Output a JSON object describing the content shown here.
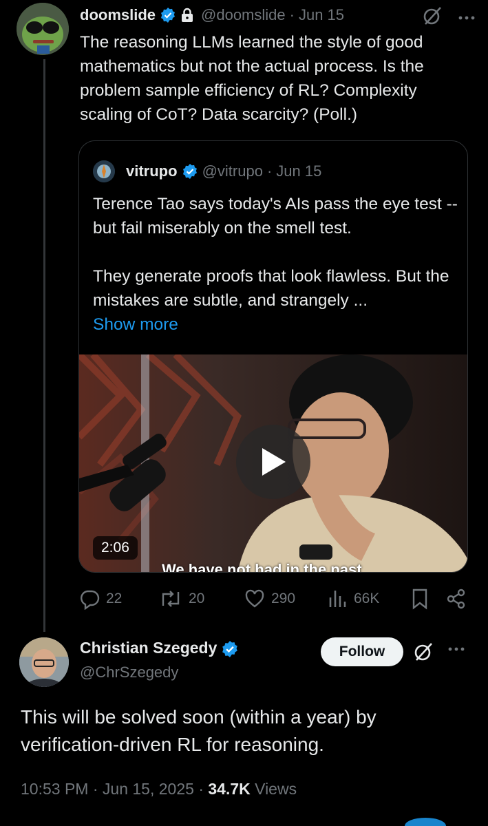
{
  "tweet1": {
    "name": "doomslide",
    "handle": "@doomslide",
    "dot": "·",
    "date": "Jun 15",
    "more_icon": "more-horizontal-icon",
    "text": "The reasoning LLMs learned the style of good mathematics but not the actual process. Is the problem sample efficiency of RL? Complexity scaling of CoT? Data scarcity? (Poll.)"
  },
  "quote": {
    "name": "vitrupo",
    "handle": "@vitrupo",
    "dot": "·",
    "date": "Jun 15",
    "paragraph1": "Terence Tao says today's AIs pass the eye test -- but fail miserably on the smell test.",
    "paragraph2": "They generate proofs that look flawless. But the mistakes are subtle, and strangely ...",
    "show_more": "Show more",
    "video": {
      "duration": "2:06",
      "subtitle": "We have not had in the past"
    }
  },
  "actions": {
    "replies": "22",
    "retweets": "20",
    "likes": "290",
    "views": "66K"
  },
  "tweet2": {
    "name": "Christian Szegedy",
    "handle": "@ChrSzegedy",
    "follow_label": "Follow",
    "text": "This will be solved soon (within a year) by verification-driven RL for reasoning.",
    "time": "10:53 PM",
    "dot": "·",
    "date": "Jun 15, 2025",
    "dot2": "·",
    "views_count": "34.7K",
    "views_label": "Views"
  },
  "colors": {
    "background": "#000000",
    "text": "#e7e9ea",
    "secondary": "#71767b",
    "accent": "#1d9bf0"
  }
}
